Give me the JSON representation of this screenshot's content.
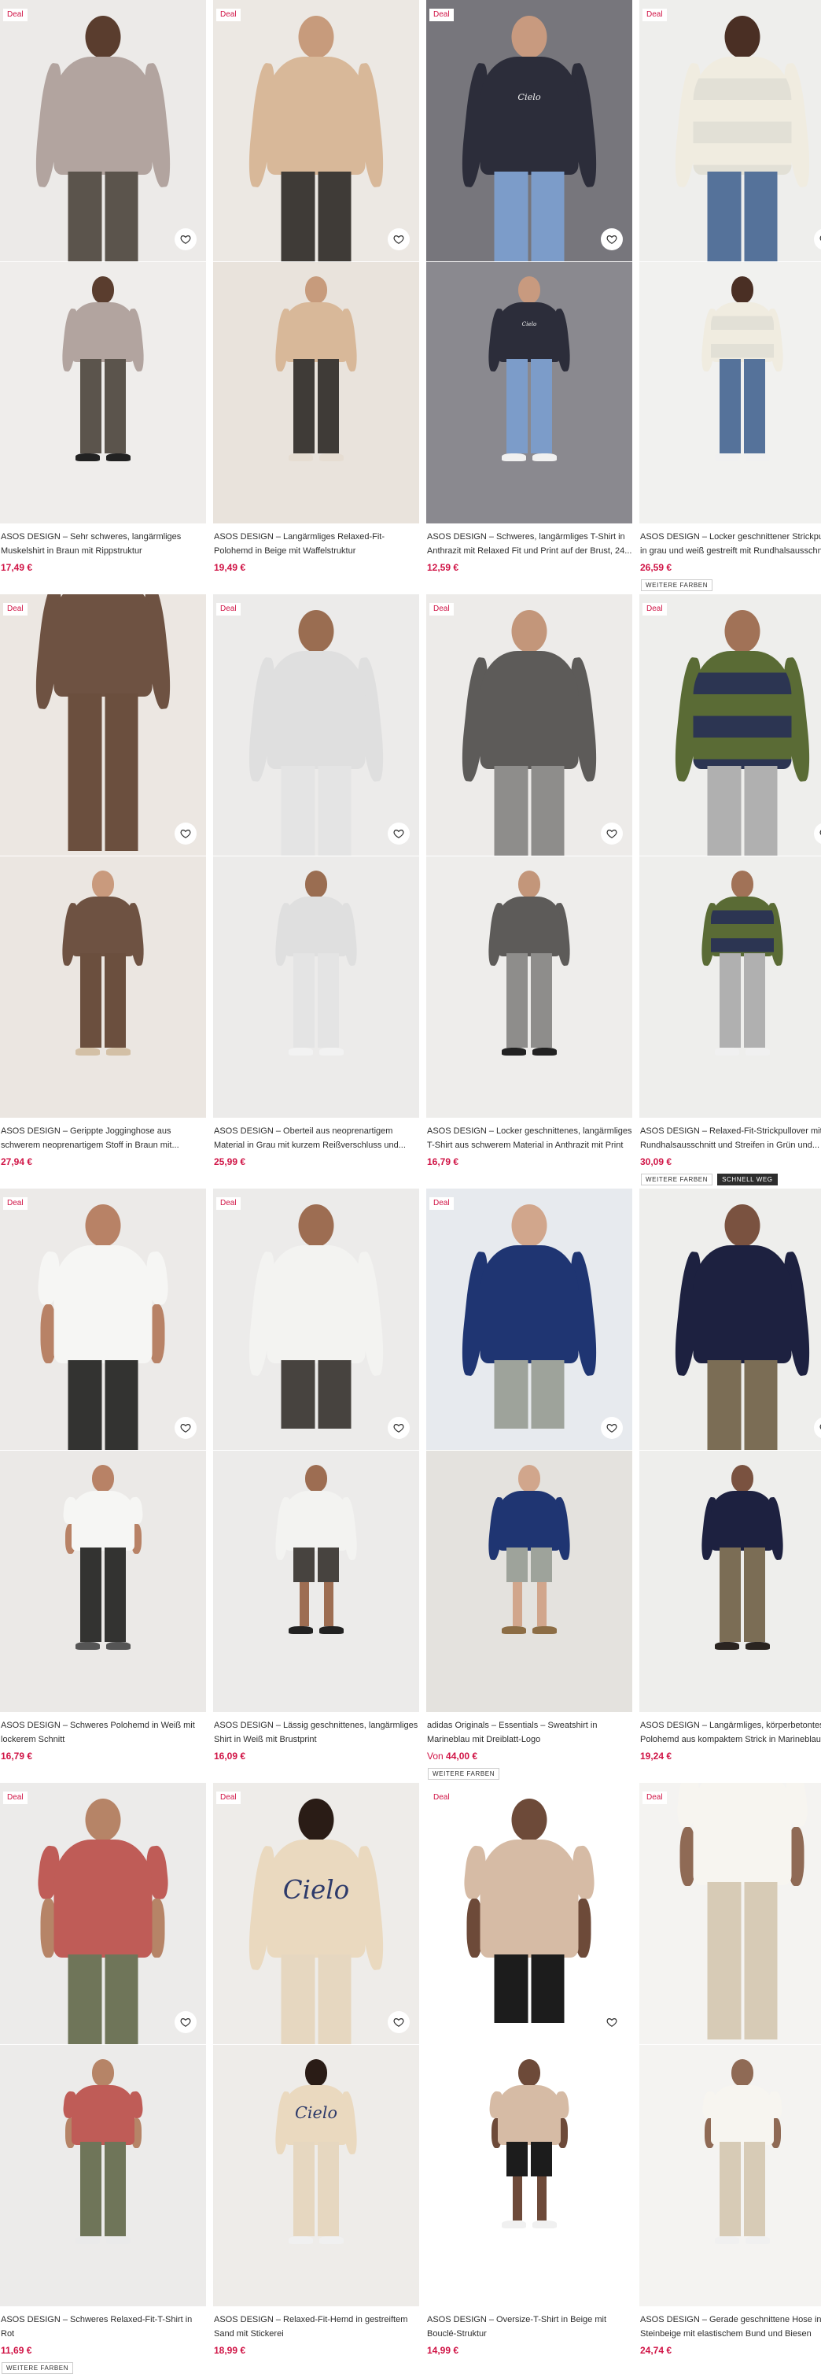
{
  "colors": {
    "price": "#d01345",
    "deal_text": "#d01345",
    "text": "#2d2d2d"
  },
  "icons": {
    "wishlist": "heart-icon"
  },
  "products": [
    {
      "deal": "Deal",
      "title": "ASOS DESIGN – Sehr schweres, langärmliges Muskelshirt in Braun mit Rippstruktur",
      "price": "17,49 €",
      "bg1": "#eceae8",
      "bg2": "#efedeb",
      "top": "#b2a49f",
      "bottom": "#5b544c",
      "skin": "#5a3d2e",
      "sleeve": "long",
      "shoe": "#222",
      "heart": true
    },
    {
      "deal": "Deal",
      "title": "ASOS DESIGN – Langärmliges Relaxed-Fit-Polohemd in Beige mit Waffelstruktur",
      "price": "19,49 €",
      "bg1": "#ece8e3",
      "bg2": "#e9e3dc",
      "top": "#d8b899",
      "bottom": "#3f3b37",
      "skin": "#c79b7c",
      "sleeve": "long",
      "shoe": "#e6ddd2",
      "heart": true
    },
    {
      "deal": "Deal",
      "title": "ASOS DESIGN – Schweres, langärmliges T-Shirt in Anthrazit mit Relaxed Fit und Print auf der Brust, 24...",
      "price": "12,59 €",
      "bg1": "#77767c",
      "bg2": "#8a898f",
      "top": "#2c2d3a",
      "bottom": "#7c9cc9",
      "skin": "#c89a7f",
      "sleeve": "long",
      "shoe": "#f0f0f0",
      "heart": true,
      "print": "Cielo"
    },
    {
      "deal": "Deal",
      "title": "ASOS DESIGN – Locker geschnittener Strickpullover in grau und weiß gestreift mit Rundhalsausschnitt",
      "price": "26,59 €",
      "tags": [
        "WEITERE FARBEN"
      ],
      "bg1": "#eeeeec",
      "bg2": "#f1f1ef",
      "top": "#f0ece0",
      "bottom": "#55729a",
      "skin": "#4a2f24",
      "sleeve": "long",
      "shoe": "#f0f0f0",
      "heart": true,
      "stripe": "#e2e0d6"
    },
    {
      "deal": "Deal",
      "title": "ASOS DESIGN – Gerippte Jogginghose aus schwerem neoprenartigem Stoff in Braun mit...",
      "price": "27,94 €",
      "bg1": "#ece7e2",
      "bg2": "#ebe6e1",
      "top": "#6e5242",
      "bottom": "#6b4f3e",
      "skin": "#c99a7d",
      "sleeve": "long",
      "shoe": "#d3c0a6",
      "heart": true,
      "crop": "legs"
    },
    {
      "deal": "Deal",
      "title": "ASOS DESIGN – Oberteil aus neoprenartigem Material in Grau mit kurzem Reißverschluss und...",
      "price": "25,99 €",
      "bg1": "#ecebea",
      "bg2": "#ecebea",
      "top": "#dfdfdf",
      "bottom": "#e4e4e4",
      "skin": "#9a6d51",
      "sleeve": "long",
      "shoe": "#f2f2f2",
      "heart": true
    },
    {
      "deal": "Deal",
      "title": "ASOS DESIGN – Locker geschnittenes, langärmliges T-Shirt aus schwerem Material in Anthrazit mit Print",
      "price": "16,79 €",
      "bg1": "#edebe9",
      "bg2": "#eeedeb",
      "top": "#5d5b59",
      "bottom": "#8e8d8b",
      "skin": "#c3967a",
      "sleeve": "long",
      "shoe": "#222",
      "heart": true
    },
    {
      "deal": "Deal",
      "title": "ASOS DESIGN – Relaxed-Fit-Strickpullover mit Rundhalsausschnitt und Streifen in Grün und...",
      "price": "30,09 €",
      "tags": [
        "WEITERE FARBEN",
        "SCHNELL WEG"
      ],
      "bg1": "#eeeeec",
      "bg2": "#eeeeec",
      "top": "#5a6b35",
      "bottom": "#b0b0b0",
      "skin": "#a17257",
      "sleeve": "long",
      "shoe": "#f0f0f0",
      "heart": true,
      "stripe": "#2c3552"
    },
    {
      "deal": "Deal",
      "title": "ASOS DESIGN – Schweres Polohemd in Weiß mit lockerem Schnitt",
      "price": "16,79 €",
      "bg1": "#eceae8",
      "bg2": "#ebe9e7",
      "top": "#f6f6f4",
      "bottom": "#333331",
      "skin": "#b88266",
      "sleeve": "short",
      "shoe": "#555",
      "heart": true
    },
    {
      "deal": "Deal",
      "title": "ASOS DESIGN – Lässig geschnittenes, langärmliges Shirt in Weiß mit Brustprint",
      "price": "16,09 €",
      "bg1": "#ecebea",
      "bg2": "#ecebea",
      "top": "#f3f3f1",
      "bottom": "#47433f",
      "skin": "#9d6d52",
      "sleeve": "long",
      "shoe": "#222",
      "heart": true,
      "shorts": true
    },
    {
      "deal": "Deal",
      "title": "adidas Originals – Essentials – Sweatshirt in Marineblau mit Dreiblatt-Logo",
      "price": "44,00 €",
      "price_prefix": "Von",
      "tags": [
        "WEITERE FARBEN"
      ],
      "bg1": "#e7eaee",
      "bg2": "#e4e2de",
      "top": "#1f3572",
      "bottom": "#9ea39b",
      "skin": "#d1a68c",
      "sleeve": "long",
      "shoe": "#8c6d45",
      "heart": true,
      "shorts": true
    },
    {
      "deal": "",
      "title": "ASOS DESIGN – Langärmliges, körperbetontes Polohemd aus kompaktem Strick in Marineblau",
      "price": "19,24 €",
      "bg1": "#eeeeec",
      "bg2": "#eeeeec",
      "top": "#1d2140",
      "bottom": "#7b6d55",
      "skin": "#7a5240",
      "sleeve": "long",
      "shoe": "#2a2420",
      "heart": true
    },
    {
      "deal": "Deal",
      "title": "ASOS DESIGN – Schweres Relaxed-Fit-T-Shirt in Rot",
      "price": "11,69 €",
      "tags": [
        "WEITERE FARBEN"
      ],
      "bg1": "#ecebea",
      "bg2": "#ecebea",
      "top": "#bf5c57",
      "bottom": "#6f7559",
      "skin": "#b68467",
      "sleeve": "short",
      "shoe": "#eaeaea",
      "heart": true
    },
    {
      "deal": "Deal",
      "title": "ASOS DESIGN – Relaxed-Fit-Hemd in gestreiftem Sand mit Stickerei",
      "price": "18,99 €",
      "bg1": "#eeece9",
      "bg2": "#eeece9",
      "top": "#ead9bf",
      "bottom": "#e6d7c0",
      "skin": "#5e3e2f",
      "sleeve": "long",
      "shoe": "#f0f0f0",
      "heart": true,
      "print": "Cielo",
      "back": true
    },
    {
      "deal": "Deal",
      "title": "ASOS DESIGN – Oversize-T-Shirt in Beige mit Bouclé-Struktur",
      "price": "14,99 €",
      "bg1": "#ffffff",
      "bg2": "#ffffff",
      "top": "#d6bba5",
      "bottom": "#1c1c1c",
      "skin": "#6d4a39",
      "sleeve": "short",
      "shoe": "#f0f0f0",
      "heart": true,
      "shorts": true
    },
    {
      "deal": "Deal",
      "title": "ASOS DESIGN – Gerade geschnittene Hose in Steinbeige mit elastischem Bund und Biesen",
      "price": "24,74 €",
      "bg1": "#f4f3f1",
      "bg2": "#f4f3f1",
      "top": "#f7f5f0",
      "bottom": "#d7cbb6",
      "skin": "#8f6a55",
      "sleeve": "short",
      "shoe": "#f0f0f0",
      "heart": false,
      "crop": "legs"
    }
  ]
}
